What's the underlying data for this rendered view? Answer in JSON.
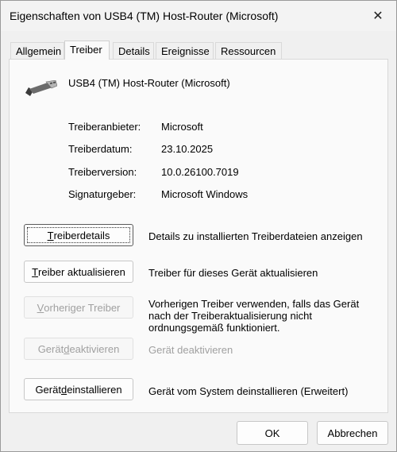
{
  "window": {
    "title": "Eigenschaften von USB4 (TM) Host-Router (Microsoft)",
    "close_glyph": "✕"
  },
  "tabs": [
    {
      "label": "Allgemein"
    },
    {
      "label": "Treiber"
    },
    {
      "label": "Details"
    },
    {
      "label": "Ereignisse"
    },
    {
      "label": "Ressourcen"
    }
  ],
  "device": {
    "icon": "usb-plug-icon",
    "name": "USB4 (TM) Host-Router (Microsoft)"
  },
  "driver_info": [
    {
      "label": "Treiberanbieter:",
      "value": "Microsoft"
    },
    {
      "label": "Treiberdatum:",
      "value": "23.10.2025"
    },
    {
      "label": "Treiberversion:",
      "value": "10.0.26100.7019"
    },
    {
      "label": "Signaturgeber:",
      "value": "Microsoft Windows"
    }
  ],
  "actions": [
    {
      "accel": "T",
      "rest": "reiberdetails",
      "description": "Details zu installierten Treiberdateien anzeigen",
      "enabled": true
    },
    {
      "accel": "T",
      "rest": "reiber aktualisieren",
      "description": "Treiber für dieses Gerät aktualisieren",
      "enabled": true
    },
    {
      "accel": "V",
      "rest": "orheriger Treiber",
      "description": "Vorherigen Treiber verwenden, falls das Gerät nach der Treiberaktualisierung nicht ordnungsgemäß funktioniert.",
      "enabled": false
    },
    {
      "prefix": "Gerät ",
      "accel": "d",
      "rest": "eaktivieren",
      "description": "Gerät deaktivieren",
      "enabled": false
    },
    {
      "prefix": "Gerät ",
      "accel": "d",
      "rest": "einstallieren",
      "description": "Gerät vom System deinstallieren (Erweitert)",
      "enabled": true
    }
  ],
  "footer": {
    "ok": "OK",
    "cancel": "Abbrechen"
  }
}
